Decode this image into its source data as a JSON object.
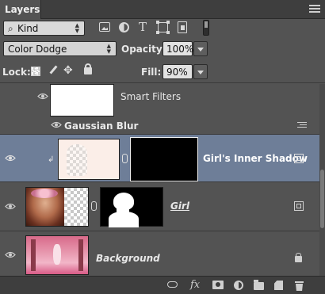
{
  "panel": {
    "tab_label": "Layers"
  },
  "filter": {
    "kind_label": "Kind",
    "icons": [
      "image-filter-icon",
      "adjustment-filter-icon",
      "type-filter-icon",
      "shape-filter-icon",
      "smart-object-filter-icon"
    ]
  },
  "blend": {
    "mode": "Color Dodge",
    "opacity_label": "Opacity:",
    "opacity_value": "100%",
    "fill_label": "Fill:",
    "fill_value": "90%"
  },
  "lock": {
    "label": "Lock:",
    "icons": [
      "lock-transparent-pixels-icon",
      "lock-image-pixels-icon",
      "lock-position-icon",
      "lock-all-icon"
    ]
  },
  "layers": [
    {
      "type": "smart-filters-header",
      "label": "Smart Filters",
      "visible": true
    },
    {
      "type": "filter",
      "label": "Gaussian Blur",
      "visible": true
    },
    {
      "type": "layer",
      "name": "Girl's Inner Shadow",
      "selected": true,
      "clipped": true,
      "visible": true
    },
    {
      "type": "layer",
      "name": "Girl",
      "underlined": true,
      "visible": true
    },
    {
      "type": "layer",
      "name": "Background",
      "locked": true,
      "visible": true
    }
  ],
  "bottom_icons": [
    "link-layers-icon",
    "fx-icon",
    "add-mask-icon",
    "adjustment-layer-icon",
    "new-group-icon",
    "new-layer-icon",
    "delete-layer-icon"
  ],
  "bottom_fx_label": "fx",
  "colors": {
    "panel_bg": "#535353",
    "selected_row": "#6e7e98",
    "tab_bar": "#3e3e3e"
  }
}
